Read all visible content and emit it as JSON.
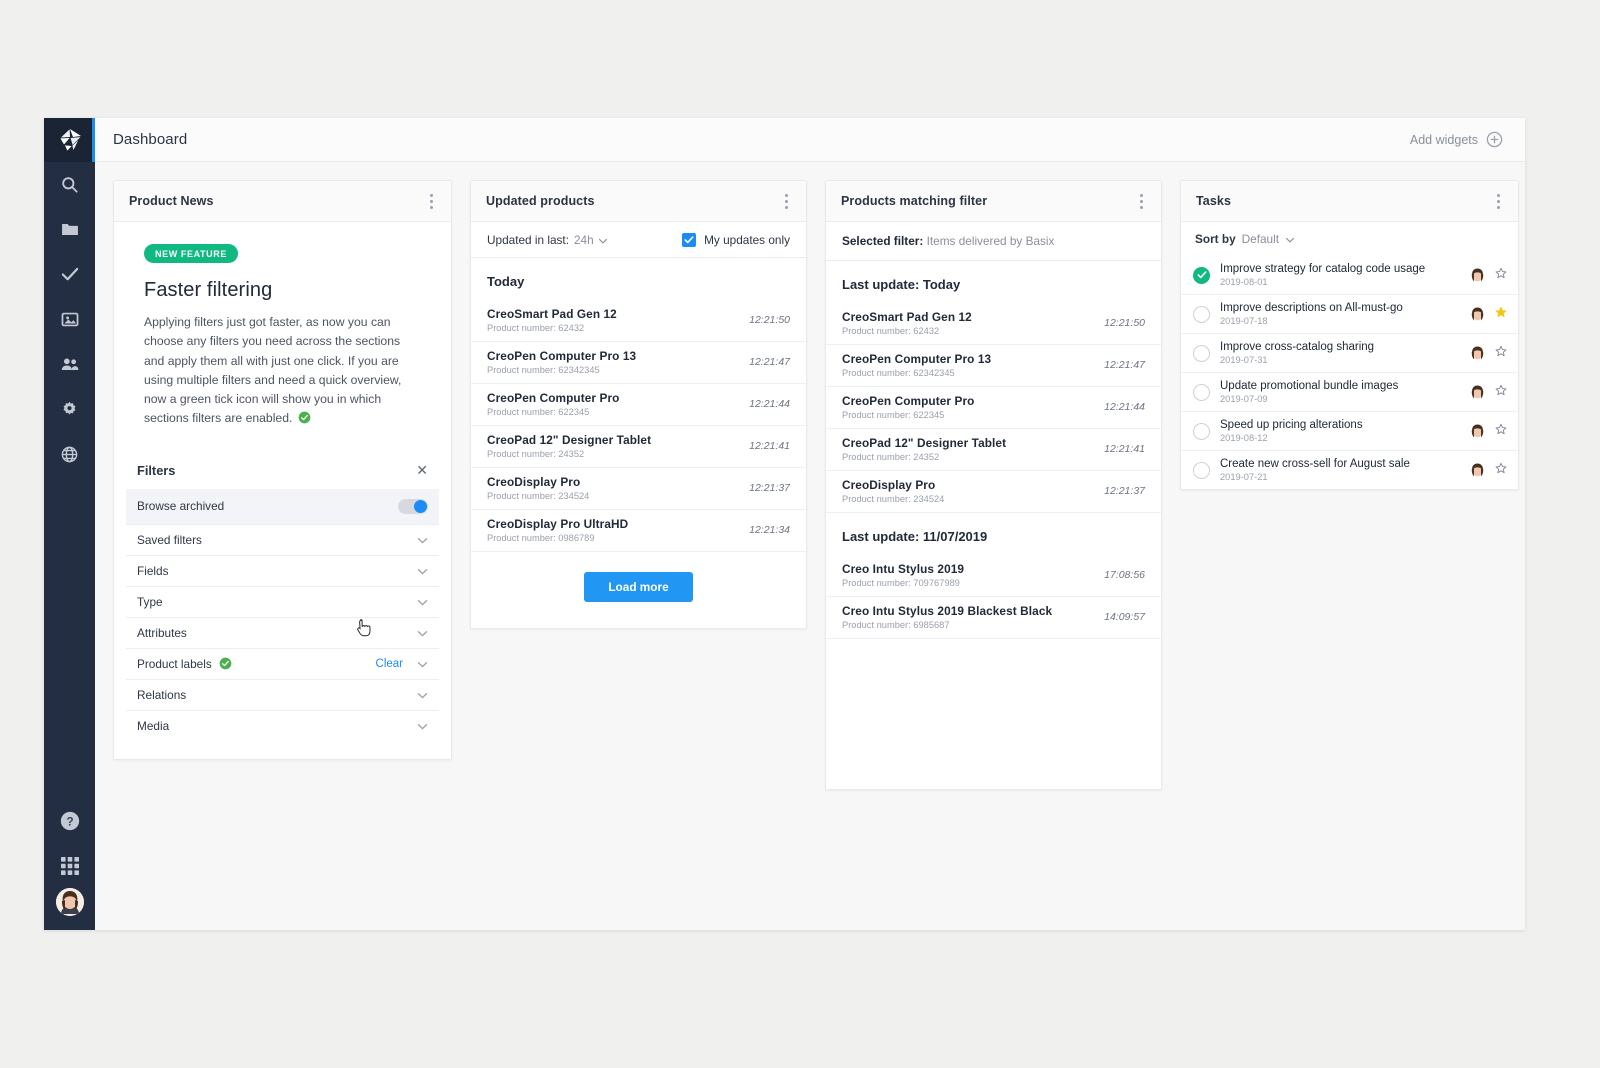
{
  "app": {
    "logo_icon": "origami-bird-logo",
    "header": {
      "title": "Dashboard",
      "add_widgets_label": "Add widgets",
      "add_widgets_icon": "plus-circle-icon"
    },
    "sidebar": {
      "items": [
        {
          "name": "search",
          "icon": "search-icon"
        },
        {
          "name": "folder",
          "icon": "folder-icon"
        },
        {
          "name": "tasks",
          "icon": "check-icon"
        },
        {
          "name": "media",
          "icon": "image-icon"
        },
        {
          "name": "users",
          "icon": "users-icon"
        },
        {
          "name": "settings",
          "icon": "gear-icon"
        },
        {
          "name": "portal",
          "icon": "globe-icon"
        }
      ],
      "bottom": [
        {
          "name": "help",
          "icon": "question-circle-icon"
        },
        {
          "name": "apps",
          "icon": "grid-apps-icon"
        },
        {
          "name": "account",
          "icon": "user-avatar"
        }
      ]
    },
    "colors": {
      "sidebar_bg": "#232e42",
      "accent_blue": "#1b8cf5",
      "button_blue": "#2196f3",
      "green": "#10b981",
      "star_yellow": "#f5c518"
    }
  },
  "product_news": {
    "card_title": "Product News",
    "menu_icon": "kebab-menu-icon",
    "badge": "NEW FEATURE",
    "headline": "Faster filtering",
    "body": "Applying filters just got faster, as now you can choose any filters you need across the sections and apply them all with just one click. If you are using multiple filters and need a quick overview, now a green tick icon will show you in which sections filters are enabled.",
    "filters": {
      "title": "Filters",
      "close_icon": "close-icon",
      "clear_label": "Clear",
      "rows": [
        {
          "label": "Browse archived",
          "control": "toggle",
          "toggle_on": true
        },
        {
          "label": "Saved filters",
          "control": "chevron"
        },
        {
          "label": "Fields",
          "control": "chevron"
        },
        {
          "label": "Type",
          "control": "chevron"
        },
        {
          "label": "Attributes",
          "control": "chevron"
        },
        {
          "label": "Product labels",
          "control": "chevron",
          "has_green_check": true,
          "has_clear": true
        },
        {
          "label": "Relations",
          "control": "chevron"
        },
        {
          "label": "Media",
          "control": "chevron"
        }
      ]
    }
  },
  "updated_products": {
    "card_title": "Updated products",
    "menu_icon": "kebab-menu-icon",
    "filter_label": "Updated in last:",
    "filter_value": "24h",
    "checkbox_label": "My updates only",
    "checkbox_checked": true,
    "group_title": "Today",
    "items": [
      {
        "name": "CreoSmart Pad Gen 12",
        "number": "Product number: 62432",
        "time": "12:21:50"
      },
      {
        "name": "CreoPen Computer Pro 13",
        "number": "Product number: 62342345",
        "time": "12:21:47"
      },
      {
        "name": "CreoPen Computer Pro",
        "number": "Product number: 622345",
        "time": "12:21:44"
      },
      {
        "name": "CreoPad 12\" Designer Tablet",
        "number": "Product number: 24352",
        "time": "12:21:41"
      },
      {
        "name": "CreoDisplay Pro",
        "number": "Product number: 234524",
        "time": "12:21:37"
      },
      {
        "name": "CreoDisplay Pro UltraHD",
        "number": "Product number: 0986789",
        "time": "12:21:34"
      }
    ],
    "load_more_label": "Load more"
  },
  "products_matching_filter": {
    "card_title": "Products matching filter",
    "menu_icon": "kebab-menu-icon",
    "selected_filter_label": "Selected filter:",
    "selected_filter_value": "Items delivered by Basix",
    "groups": [
      {
        "title": "Last update: Today",
        "items": [
          {
            "name": "CreoSmart Pad Gen 12",
            "number": "Product number: 62432",
            "time": "12:21:50"
          },
          {
            "name": "CreoPen Computer Pro 13",
            "number": "Product number: 62342345",
            "time": "12:21:47"
          },
          {
            "name": "CreoPen Computer Pro",
            "number": "Product number: 622345",
            "time": "12:21:44"
          },
          {
            "name": "CreoPad 12\" Designer Tablet",
            "number": "Product number: 24352",
            "time": "12:21:41"
          },
          {
            "name": "CreoDisplay Pro",
            "number": "Product number: 234524",
            "time": "12:21:37"
          }
        ]
      },
      {
        "title": "Last update: 11/07/2019",
        "items": [
          {
            "name": "Creo Intu Stylus 2019",
            "number": "Product number: 709767989",
            "time": "17:08:56"
          },
          {
            "name": "Creo Intu Stylus 2019 Blackest Black",
            "number": "Product number: 6985687",
            "time": "14:09:57"
          }
        ]
      }
    ]
  },
  "tasks": {
    "card_title": "Tasks",
    "menu_icon": "kebab-menu-icon",
    "sort_label": "Sort by",
    "sort_value": "Default",
    "items": [
      {
        "title": "Improve strategy for catalog code usage",
        "date": "2019-08-01",
        "done": true,
        "starred": false
      },
      {
        "title": "Improve descriptions on All-must-go",
        "date": "2019-07-18",
        "done": false,
        "starred": true
      },
      {
        "title": "Improve cross-catalog sharing",
        "date": "2019-07-31",
        "done": false,
        "starred": false
      },
      {
        "title": "Update promotional bundle images",
        "date": "2019-07-09",
        "done": false,
        "starred": false
      },
      {
        "title": "Speed up pricing alterations",
        "date": "2019-08-12",
        "done": false,
        "starred": false
      },
      {
        "title": "Create new cross-sell for August sale",
        "date": "2019-07-21",
        "done": false,
        "starred": false
      }
    ]
  }
}
